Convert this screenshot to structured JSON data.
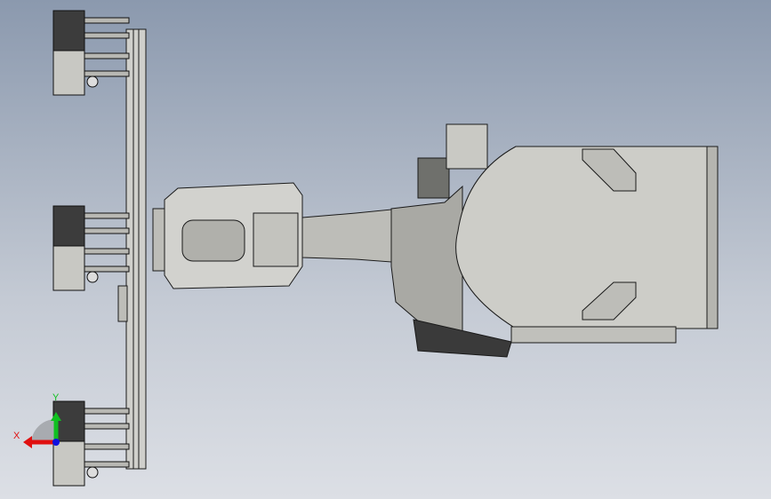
{
  "viewport": {
    "name": "cad-3d-viewport"
  },
  "triad": {
    "x_label": "X",
    "y_label": "Y",
    "x_color": "#e01010",
    "y_color": "#10c020",
    "z_color": "#1010e0"
  },
  "model": {
    "body_color": "#c9c9c4",
    "dark_color": "#3a3a3a",
    "edge_color": "#1a1a1a"
  }
}
